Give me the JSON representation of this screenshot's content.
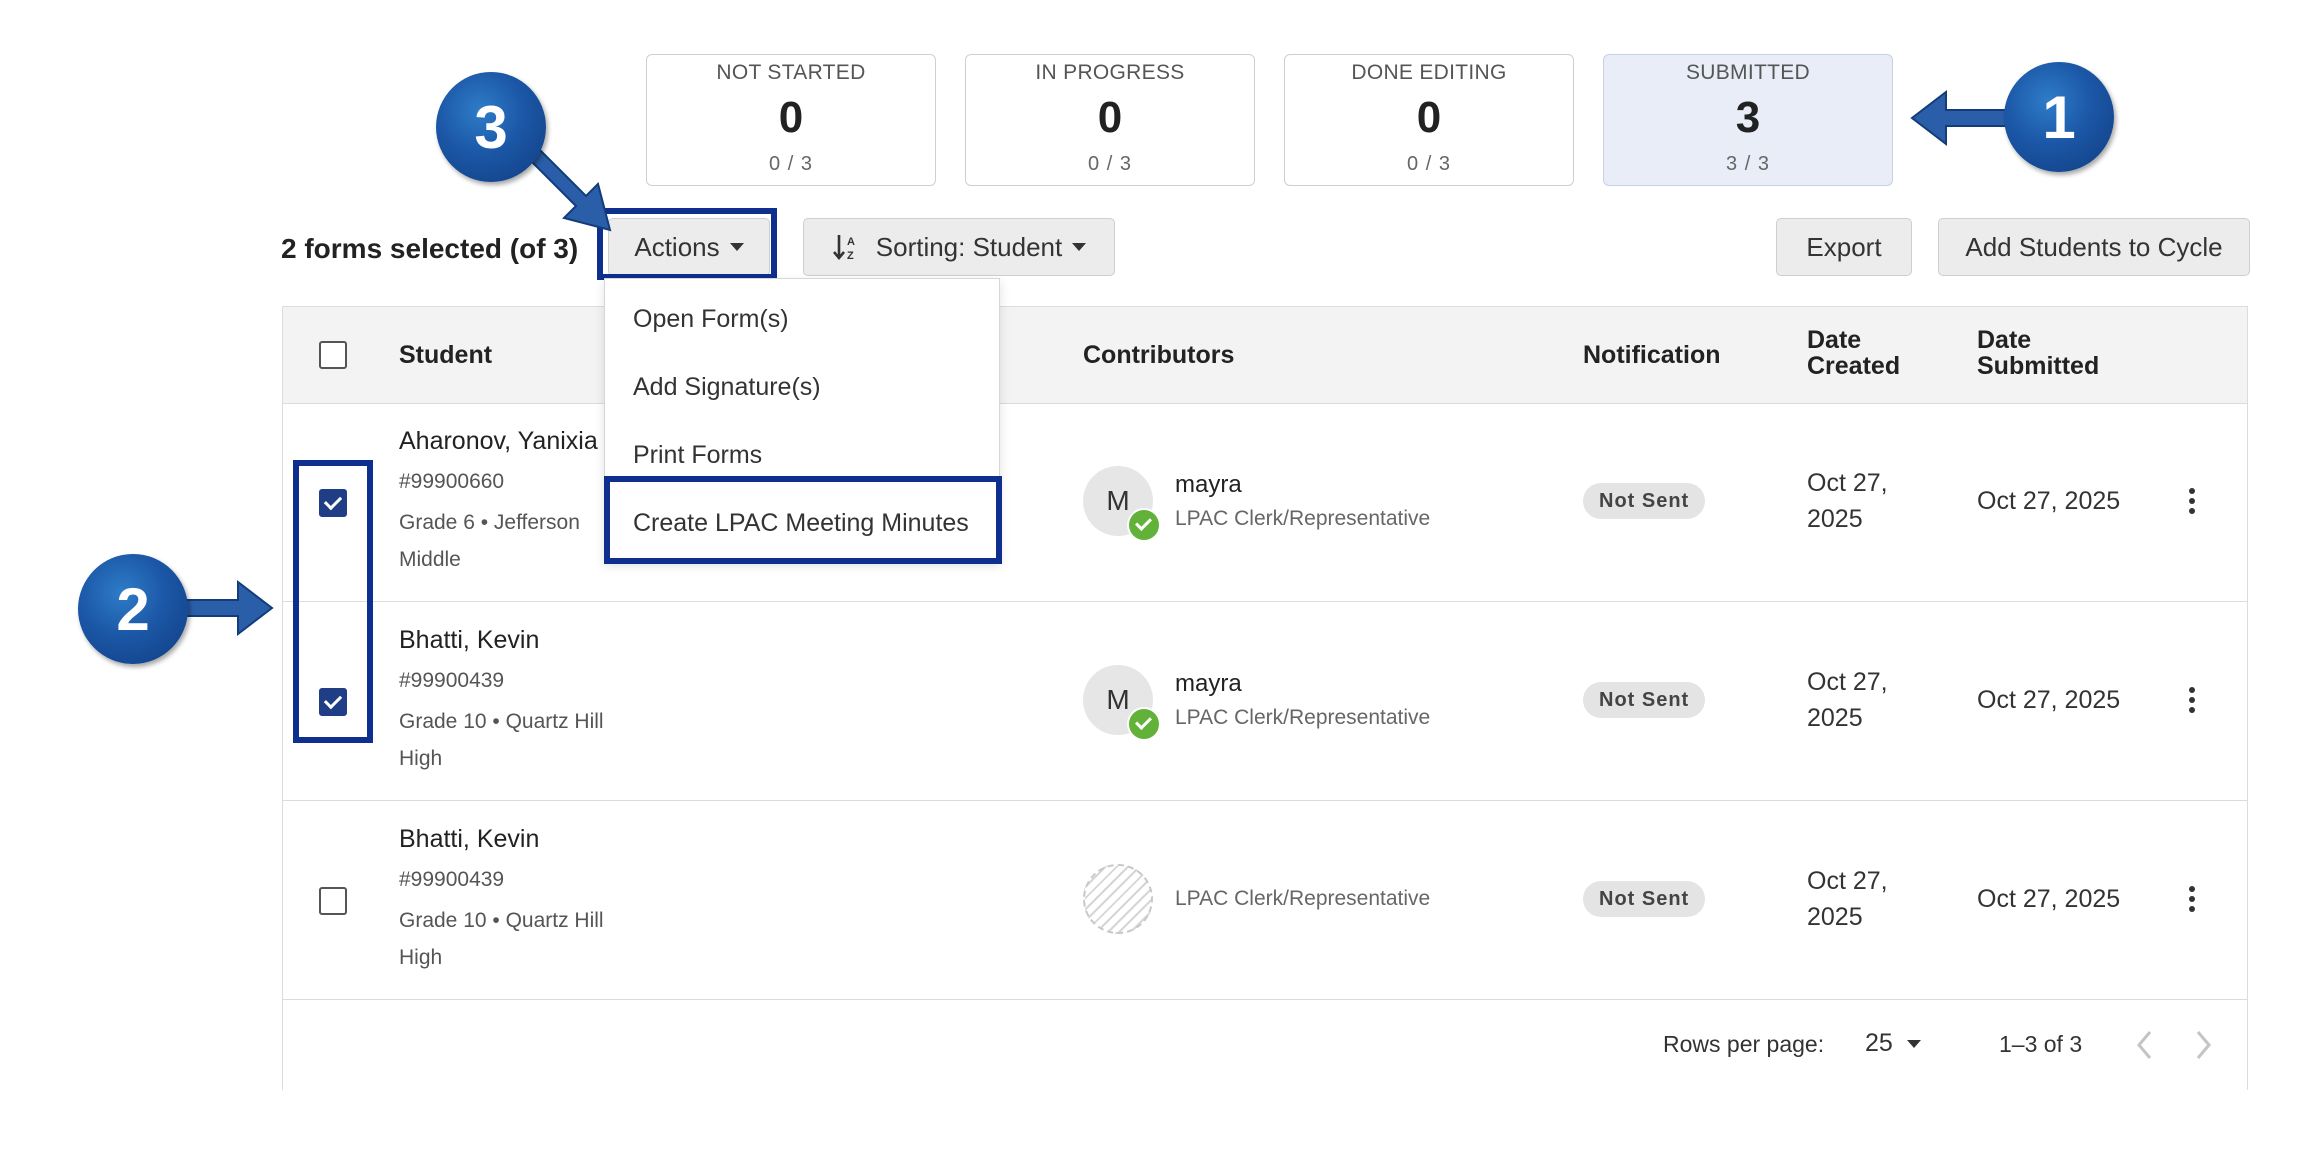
{
  "status_cards": [
    {
      "label": "NOT STARTED",
      "count": "0",
      "fraction": "0 / 3"
    },
    {
      "label": "IN PROGRESS",
      "count": "0",
      "fraction": "0 / 3"
    },
    {
      "label": "DONE EDITING",
      "count": "0",
      "fraction": "0 / 3"
    },
    {
      "label": "SUBMITTED",
      "count": "3",
      "fraction": "3 / 3"
    }
  ],
  "toolbar": {
    "selection_text": "2 forms selected (of 3)",
    "actions_label": "Actions",
    "sorting_label": "Sorting: Student",
    "export_label": "Export",
    "add_students_label": "Add Students to Cycle"
  },
  "actions_menu": {
    "items": [
      "Open Form(s)",
      "Add Signature(s)",
      "Print Forms",
      "Create LPAC Meeting Minutes"
    ]
  },
  "table": {
    "headers": {
      "student": "Student",
      "contributors": "Contributors",
      "notification": "Notification",
      "date_created_1": "Date",
      "date_created_2": "Created",
      "date_submitted_1": "Date",
      "date_submitted_2": "Submitted"
    },
    "rows": [
      {
        "checked": true,
        "name": "Aharonov, Yanixia",
        "id": "#99900660",
        "grade": "Grade 6 • Jefferson Middle",
        "contributor_initial": "M",
        "contributor_name": "mayra",
        "contributor_role": "LPAC Clerk/Representative",
        "notification": "Not Sent",
        "created_1": "Oct 27,",
        "created_2": "2025",
        "submitted": "Oct 27, 2025"
      },
      {
        "checked": true,
        "name": "Bhatti, Kevin",
        "id": "#99900439",
        "grade": "Grade 10 • Quartz Hill High",
        "contributor_initial": "M",
        "contributor_name": "mayra",
        "contributor_role": "LPAC Clerk/Representative",
        "notification": "Not Sent",
        "created_1": "Oct 27,",
        "created_2": "2025",
        "submitted": "Oct 27, 2025"
      },
      {
        "checked": false,
        "name": "Bhatti, Kevin",
        "id": "#99900439",
        "grade": "Grade 10 • Quartz Hill High",
        "contributor_initial": "",
        "contributor_name": "",
        "contributor_role": "LPAC Clerk/Representative",
        "notification": "Not Sent",
        "created_1": "Oct 27,",
        "created_2": "2025",
        "submitted": "Oct 27, 2025"
      }
    ]
  },
  "pagination": {
    "rows_per_page_label": "Rows per page:",
    "rows_per_page_value": "25",
    "range": "1–3 of 3"
  },
  "callouts": [
    "1",
    "2",
    "3"
  ],
  "colors": {
    "highlight_border": "#0f2f8f",
    "callout_blue": "#1b57a6",
    "checkbox_checked": "#203e86",
    "submitted_card_bg": "#e9edf8",
    "success_green": "#62b23a"
  }
}
